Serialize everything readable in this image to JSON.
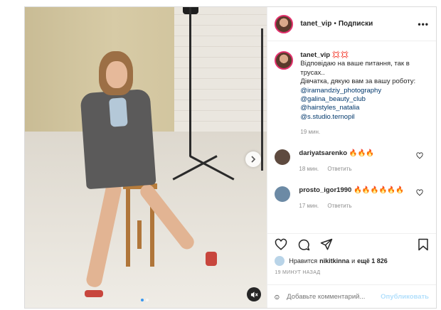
{
  "header": {
    "username": "tanet_vip",
    "separator": "•",
    "follow_label": "Подписки",
    "more_label": "•••"
  },
  "caption": {
    "username": "tanet_vip",
    "emoji": "💢💢",
    "line1": "Відповідаю на ваше питання, так в трусах..",
    "line2": "Дівчатка, дякую вам за вашу роботу:",
    "links": [
      "@iramandziy_photography",
      "@galina_beauty_club",
      "@hairstyles_natalia",
      "@s.studio.ternopil"
    ],
    "time": "19 мин."
  },
  "comments": [
    {
      "username": "dariyatsarenko",
      "text": "🔥🔥🔥",
      "time": "18 мин.",
      "reply": "Ответить",
      "avatar_color": "#5e4a3f"
    },
    {
      "username": "prosto_igor1990",
      "text": "🔥🔥🔥🔥🔥🔥",
      "time": "17 мин.",
      "reply": "Ответить",
      "avatar_color": "#6c8aa5"
    }
  ],
  "likes": {
    "prefix": "Нравится",
    "user": "nikitkinna",
    "and": "и",
    "count_label": "ещё 1 826"
  },
  "ago": "19 МИНУТ НАЗАД",
  "add_comment": {
    "placeholder": "Добавьте комментарий...",
    "publish_label": "Опубликовать"
  },
  "carousel": {
    "total": 2,
    "active": 1
  },
  "colors": {
    "link": "#00376b",
    "muted": "#8e8e8e",
    "story_ring": "#e1306c",
    "publish": "#b2dffc",
    "dot_active": "#3897f0"
  },
  "icons": [
    "heart-icon",
    "comment-icon",
    "share-icon",
    "bookmark-icon",
    "emoji-icon",
    "chevron-right-icon",
    "sound-off-icon"
  ]
}
